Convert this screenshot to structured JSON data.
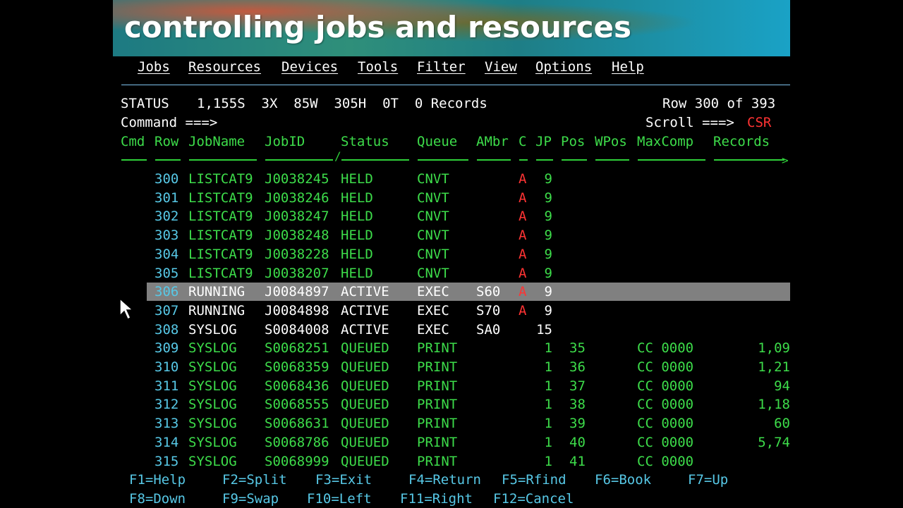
{
  "banner": {
    "title": "controlling jobs and resources"
  },
  "menu": [
    "Jobs",
    "Resources",
    "Devices",
    "Tools",
    "Filter",
    "View",
    "Options",
    "Help"
  ],
  "status": {
    "label": "STATUS",
    "summary": "1,155S  3X  85W  305H  0T  0 Records",
    "row_info": "Row 300 of 393"
  },
  "command": {
    "label": "Command ===>",
    "scroll_label": "Scroll ===>",
    "scroll_value": "CSR"
  },
  "columns": [
    "Cmd",
    "Row",
    "JobName",
    "JobID",
    "Status",
    "Queue",
    "AMbr",
    "C",
    "JP",
    "Pos",
    "WPos",
    "MaxComp",
    "Records"
  ],
  "rows": [
    {
      "row": "300",
      "jobname": "LISTCAT9",
      "jobid": "J0038245",
      "status": "HELD",
      "queue": "CNVT",
      "ambr": "",
      "c": "A",
      "jp": "9",
      "pos": "",
      "maxcomp": "",
      "records": "",
      "style": "green"
    },
    {
      "row": "301",
      "jobname": "LISTCAT9",
      "jobid": "J0038246",
      "status": "HELD",
      "queue": "CNVT",
      "ambr": "",
      "c": "A",
      "jp": "9",
      "pos": "",
      "maxcomp": "",
      "records": "",
      "style": "green"
    },
    {
      "row": "302",
      "jobname": "LISTCAT9",
      "jobid": "J0038247",
      "status": "HELD",
      "queue": "CNVT",
      "ambr": "",
      "c": "A",
      "jp": "9",
      "pos": "",
      "maxcomp": "",
      "records": "",
      "style": "green"
    },
    {
      "row": "303",
      "jobname": "LISTCAT9",
      "jobid": "J0038248",
      "status": "HELD",
      "queue": "CNVT",
      "ambr": "",
      "c": "A",
      "jp": "9",
      "pos": "",
      "maxcomp": "",
      "records": "",
      "style": "green"
    },
    {
      "row": "304",
      "jobname": "LISTCAT9",
      "jobid": "J0038228",
      "status": "HELD",
      "queue": "CNVT",
      "ambr": "",
      "c": "A",
      "jp": "9",
      "pos": "",
      "maxcomp": "",
      "records": "",
      "style": "green"
    },
    {
      "row": "305",
      "jobname": "LISTCAT9",
      "jobid": "J0038207",
      "status": "HELD",
      "queue": "CNVT",
      "ambr": "",
      "c": "A",
      "jp": "9",
      "pos": "",
      "maxcomp": "",
      "records": "",
      "style": "green"
    },
    {
      "row": "306",
      "jobname": "RUNNING",
      "jobid": "J0084897",
      "status": "ACTIVE",
      "queue": "EXEC",
      "ambr": "S60",
      "c": "A",
      "jp": "9",
      "pos": "",
      "maxcomp": "",
      "records": "",
      "style": "white",
      "selected": true
    },
    {
      "row": "307",
      "jobname": "RUNNING",
      "jobid": "J0084898",
      "status": "ACTIVE",
      "queue": "EXEC",
      "ambr": "S70",
      "c": "A",
      "jp": "9",
      "pos": "",
      "maxcomp": "",
      "records": "",
      "style": "white"
    },
    {
      "row": "308",
      "jobname": "SYSLOG",
      "jobid": "S0084008",
      "status": "ACTIVE",
      "queue": "EXEC",
      "ambr": "SA0",
      "c": "",
      "jp": "15",
      "pos": "",
      "maxcomp": "",
      "records": "",
      "style": "white"
    },
    {
      "row": "309",
      "jobname": "SYSLOG",
      "jobid": "S0068251",
      "status": "QUEUED",
      "queue": "PRINT",
      "ambr": "",
      "c": "",
      "jp": "1",
      "pos": "35",
      "maxcomp": "CC 0000",
      "records": "1,09",
      "style": "green"
    },
    {
      "row": "310",
      "jobname": "SYSLOG",
      "jobid": "S0068359",
      "status": "QUEUED",
      "queue": "PRINT",
      "ambr": "",
      "c": "",
      "jp": "1",
      "pos": "36",
      "maxcomp": "CC 0000",
      "records": "1,21",
      "style": "green"
    },
    {
      "row": "311",
      "jobname": "SYSLOG",
      "jobid": "S0068436",
      "status": "QUEUED",
      "queue": "PRINT",
      "ambr": "",
      "c": "",
      "jp": "1",
      "pos": "37",
      "maxcomp": "CC 0000",
      "records": "94",
      "style": "green"
    },
    {
      "row": "312",
      "jobname": "SYSLOG",
      "jobid": "S0068555",
      "status": "QUEUED",
      "queue": "PRINT",
      "ambr": "",
      "c": "",
      "jp": "1",
      "pos": "38",
      "maxcomp": "CC 0000",
      "records": "1,18",
      "style": "green"
    },
    {
      "row": "313",
      "jobname": "SYSLOG",
      "jobid": "S0068631",
      "status": "QUEUED",
      "queue": "PRINT",
      "ambr": "",
      "c": "",
      "jp": "1",
      "pos": "39",
      "maxcomp": "CC 0000",
      "records": "60",
      "style": "green"
    },
    {
      "row": "314",
      "jobname": "SYSLOG",
      "jobid": "S0068786",
      "status": "QUEUED",
      "queue": "PRINT",
      "ambr": "",
      "c": "",
      "jp": "1",
      "pos": "40",
      "maxcomp": "CC 0000",
      "records": "5,74",
      "style": "green"
    },
    {
      "row": "315",
      "jobname": "SYSLOG",
      "jobid": "S0068999",
      "status": "QUEUED",
      "queue": "PRINT",
      "ambr": "",
      "c": "",
      "jp": "1",
      "pos": "41",
      "maxcomp": "CC 0000",
      "records": "",
      "style": "green"
    }
  ],
  "fkeys_row1": [
    "F1=Help",
    "F2=Split",
    "F3=Exit",
    "F4=Return",
    "F5=Rfind",
    "F6=Book",
    "F7=Up"
  ],
  "fkeys_row2": [
    "F8=Down",
    "F9=Swap",
    "F10=Left",
    "F11=Right",
    "F12=Cancel"
  ],
  "colors": {
    "green": "#3ddc4a",
    "cyan": "#57c8e6",
    "red": "#ff3333",
    "highlight": "#808080",
    "separator": "#7ec3ef"
  },
  "icons": {
    "cursor": "mouse-pointer-icon"
  }
}
